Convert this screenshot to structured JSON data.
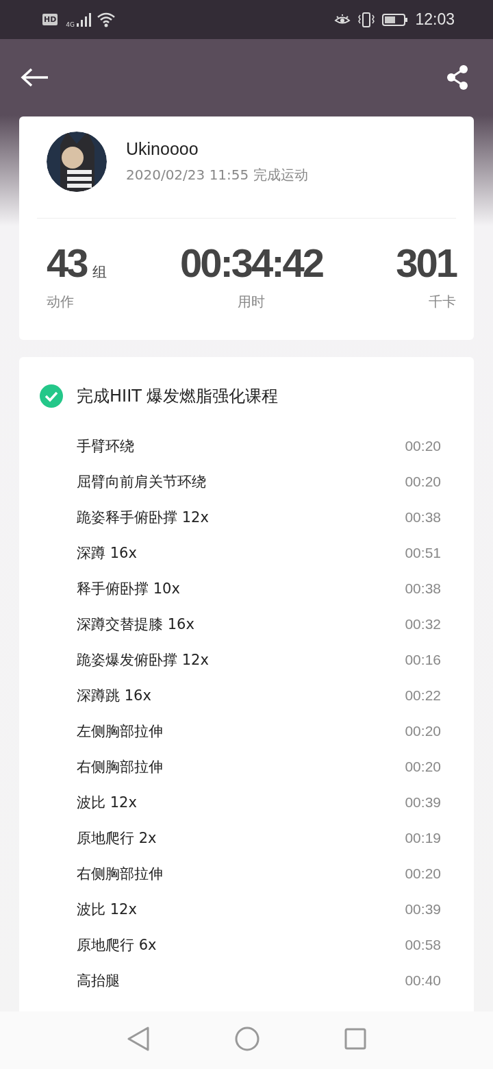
{
  "status_bar": {
    "hd": "HD",
    "network": "4G",
    "time": "12:03"
  },
  "profile": {
    "name": "Ukinoooo",
    "subtitle": "2020/02/23 11:55 完成运动"
  },
  "stats": [
    {
      "value": "43",
      "unit": "组",
      "label": "动作"
    },
    {
      "value": "00:34:42",
      "label": "用时"
    },
    {
      "value": "301",
      "label": "千卡"
    }
  ],
  "course": {
    "title": "完成HIIT 爆发燃脂强化课程",
    "completed": true,
    "exercises": [
      {
        "name": "手臂环绕",
        "time": "00:20"
      },
      {
        "name": "屈臂向前肩关节环绕",
        "time": "00:20"
      },
      {
        "name": "跪姿释手俯卧撑 12x",
        "time": "00:38"
      },
      {
        "name": "深蹲 16x",
        "time": "00:51"
      },
      {
        "name": "释手俯卧撑 10x",
        "time": "00:38"
      },
      {
        "name": "深蹲交替提膝 16x",
        "time": "00:32"
      },
      {
        "name": "跪姿爆发俯卧撑 12x",
        "time": "00:16"
      },
      {
        "name": "深蹲跳 16x",
        "time": "00:22"
      },
      {
        "name": "左侧胸部拉伸",
        "time": "00:20"
      },
      {
        "name": "右侧胸部拉伸",
        "time": "00:20"
      },
      {
        "name": "波比 12x",
        "time": "00:39"
      },
      {
        "name": "原地爬行 2x",
        "time": "00:19"
      },
      {
        "name": "右侧胸部拉伸",
        "time": "00:20"
      },
      {
        "name": "波比 12x",
        "time": "00:39"
      },
      {
        "name": "原地爬行 6x",
        "time": "00:58"
      },
      {
        "name": "高抬腿",
        "time": "00:40"
      }
    ]
  }
}
